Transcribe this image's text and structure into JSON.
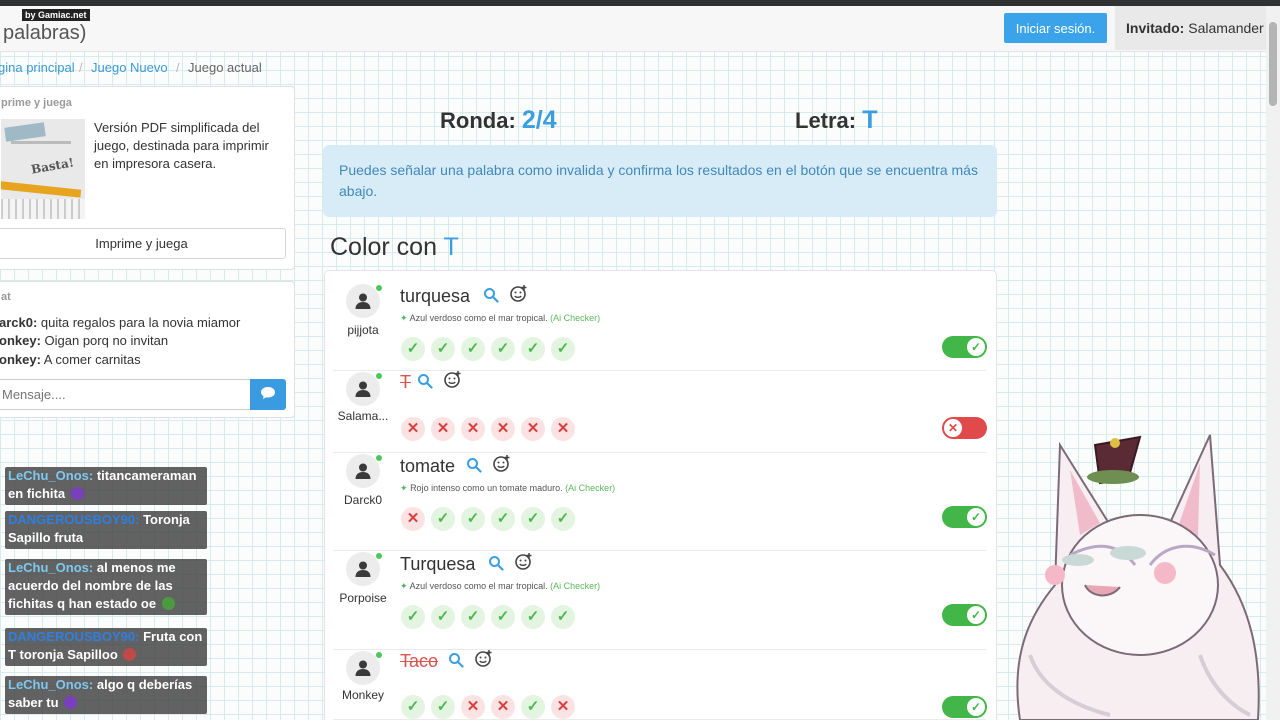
{
  "navbar": {
    "brand": "palabras)",
    "byline": "by Gamiac.net",
    "login_label": "Iniciar sesión.",
    "guest_label": "Invitado:",
    "guest_name": "Salamander"
  },
  "breadcrumb": [
    "gina principal",
    "Juego Nuevo",
    "Juego actual"
  ],
  "print_card": {
    "title": "prime y juega",
    "description": "Versión PDF simplificada del juego, destinada para imprimir en impresora casera.",
    "button_label": "Imprime y juega"
  },
  "chat": {
    "title": "at",
    "messages": [
      {
        "user": "arck0:",
        "text": " quita regalos para la novia miamor"
      },
      {
        "user": "onkey:",
        "text": " Oigan porq no invitan"
      },
      {
        "user": "onkey:",
        "text": " A comer carnitas"
      }
    ],
    "input_placeholder": "Mensaje...."
  },
  "game": {
    "round_label": "Ronda:",
    "round_value": "2/4",
    "letter_label": "Letra:",
    "letter_value": "T",
    "alert": "Puedes señalar una palabra como invalida y confirma los resultados en el botón que se encuentra más abajo.",
    "category_prefix": "Color con",
    "category_letter": "T"
  },
  "players": [
    {
      "name": "pijjota",
      "word": "turquesa",
      "invalid": false,
      "hint": "Azul verdoso como el mar tropical.",
      "checker": "(Ai Checker)",
      "votes": [
        "yes",
        "yes",
        "yes",
        "yes",
        "yes",
        "yes"
      ],
      "valid": true
    },
    {
      "name": "Salama...",
      "word": "T",
      "invalid": true,
      "hint": "",
      "checker": "",
      "votes": [
        "no",
        "no",
        "no",
        "no",
        "no",
        "no"
      ],
      "valid": false
    },
    {
      "name": "Darck0",
      "word": "tomate",
      "invalid": false,
      "hint": "Rojo intenso como un tomate maduro.",
      "checker": "(Ai Checker)",
      "votes": [
        "no",
        "yes",
        "yes",
        "yes",
        "yes",
        "yes"
      ],
      "valid": true
    },
    {
      "name": "Porpoise",
      "word": "Turquesa",
      "invalid": false,
      "hint": "Azul verdoso como el mar tropical.",
      "checker": "(Ai Checker)",
      "votes": [
        "yes",
        "yes",
        "yes",
        "yes",
        "yes",
        "yes"
      ],
      "valid": true
    },
    {
      "name": "Monkey",
      "word": "Taco",
      "invalid": true,
      "hint": "",
      "checker": "",
      "votes": [
        "yes",
        "yes",
        "no",
        "no",
        "yes",
        "no"
      ],
      "valid": true
    }
  ],
  "stream_chat": [
    {
      "user": "LeChu_Onos:",
      "text": " titancameraman en fichita",
      "user_color": "#7ec8f0",
      "emote_color": "#7a3fbf"
    },
    {
      "user": "DANGEROUSBOY90:",
      "text": " Toronja Sapillo fruta",
      "user_color": "#2f7fe0",
      "emote_color": ""
    },
    {
      "user": "LeChu_Onos:",
      "text": " al menos me acuerdo del nombre de las fichitas q han estado oe",
      "user_color": "#7ec8f0",
      "emote_color": "#4c9a3f"
    },
    {
      "user": "DANGEROUSBOY90:",
      "text": " Fruta con T toronja Sapilloo",
      "user_color": "#2f7fe0",
      "emote_color": "#c04a4a"
    },
    {
      "user": "LeChu_Onos:",
      "text": " algo q deberías saber tu",
      "user_color": "#7ec8f0",
      "emote_color": "#7a3fbf"
    }
  ],
  "colors": {
    "accent": "#3b9ee0",
    "valid": "#43b649",
    "invalid": "#e14a4a"
  }
}
